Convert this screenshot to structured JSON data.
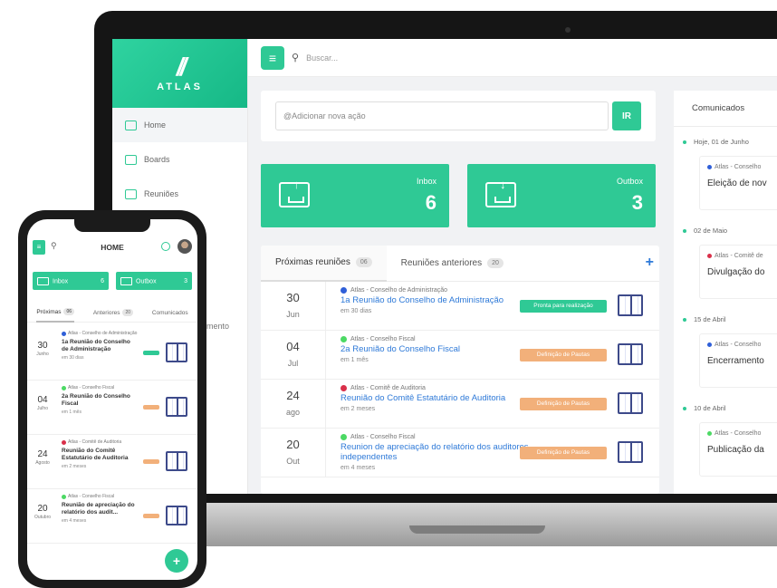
{
  "colors": {
    "accent": "#2fc995",
    "link": "#2f7ad8",
    "blue": "#2f5fd8",
    "green": "#4cd964",
    "red": "#d9304a",
    "status_ready": "#2fc995",
    "status_pending": "#f2b07a"
  },
  "laptop": {
    "brand": {
      "logo": "//",
      "name": "ATLAS"
    },
    "nav": [
      {
        "label": "Home"
      },
      {
        "label": "Boards"
      },
      {
        "label": "Reuniões"
      }
    ],
    "nav_extra": "mento",
    "search": {
      "placeholder": "Buscar..."
    },
    "action": {
      "placeholder": "@Adicionar nova ação",
      "button": "IR"
    },
    "stats": [
      {
        "label": "Inbox",
        "count": "6"
      },
      {
        "label": "Outbox",
        "count": "3"
      }
    ],
    "meetings": {
      "tabs": [
        {
          "label": "Próximas reuniões",
          "count": "06"
        },
        {
          "label": "Reuniões anteriores",
          "count": "20"
        }
      ],
      "add": "+",
      "rows": [
        {
          "day": "30",
          "month": "Jun",
          "org": "Atlas - Conselho de Administração",
          "title": "1a Reunião do Conselho de Administração",
          "when": "em 30 dias",
          "status": "Pronta para realização",
          "dot": "blue",
          "status_kind": "ready"
        },
        {
          "day": "04",
          "month": "Jul",
          "org": "Atlas - Conselho Fiscal",
          "title": "2a Reunião do Conselho Fiscal",
          "when": "em 1 mês",
          "status": "Definição de Pautas",
          "dot": "green",
          "status_kind": "pending"
        },
        {
          "day": "24",
          "month": "ago",
          "org": "Atlas - Comitê de Auditoria",
          "title": "Reunião do Comitê Estatutário de Auditoria",
          "when": "em 2 meses",
          "status": "Definição de Pautas",
          "dot": "red",
          "status_kind": "pending"
        },
        {
          "day": "20",
          "month": "Out",
          "org": "Atlas - Conselho Fiscal",
          "title": "Reunion de apreciação do relatório dos auditores independentes",
          "when": "em 4 meses",
          "status": "Definição de Pautas",
          "dot": "green",
          "status_kind": "pending"
        }
      ]
    },
    "comunicados": {
      "title": "Comunicados",
      "groups": [
        {
          "date": "Hoje, 01 de Junho",
          "org": "Atlas - Conselho",
          "title": "Eleição de nov",
          "dot": "blue"
        },
        {
          "date": "02 de Maio",
          "org": "Atlas - Comitê de",
          "title": "Divulgação do",
          "dot": "red"
        },
        {
          "date": "15 de Abril",
          "org": "Atlas - Conselho",
          "title": "Encerramento",
          "dot": "blue"
        },
        {
          "date": "10 de Abril",
          "org": "Atlas - Conselho",
          "title": "Publicação da",
          "dot": "green"
        }
      ]
    }
  },
  "phone": {
    "menu": "≡",
    "title": "HOME",
    "stats": [
      {
        "label": "Inbox",
        "count": "6"
      },
      {
        "label": "Outbox",
        "count": "3"
      }
    ],
    "tabs": [
      {
        "label": "Próximas",
        "count": "06"
      },
      {
        "label": "Anteriores",
        "count": "20"
      },
      {
        "label": "Comunicados"
      }
    ],
    "rows": [
      {
        "day": "30",
        "month": "Junho",
        "org": "Atlas - Conselho de Administração",
        "title": "1a Reunião do Conselho de Administração",
        "when": "em 30 dias",
        "dot": "blue",
        "status_kind": "ready"
      },
      {
        "day": "04",
        "month": "Julho",
        "org": "Atlas - Conselho Fiscal",
        "title": "2a Reunião do Conselho Fiscal",
        "when": "em 1 mês",
        "dot": "green",
        "status_kind": "pending"
      },
      {
        "day": "24",
        "month": "Agosto",
        "org": "Atlas - Comitê de Auditoria",
        "title": "Reunião do Comitê Estatutário de Auditoria",
        "when": "em 2 meses",
        "dot": "red",
        "status_kind": "pending"
      },
      {
        "day": "20",
        "month": "Outubro",
        "org": "Atlas - Conselho Fiscal",
        "title": "Reunião de apreciação do relatório dos audit...",
        "when": "em 4 meses",
        "dot": "green",
        "status_kind": "pending"
      }
    ],
    "fab": "+"
  }
}
